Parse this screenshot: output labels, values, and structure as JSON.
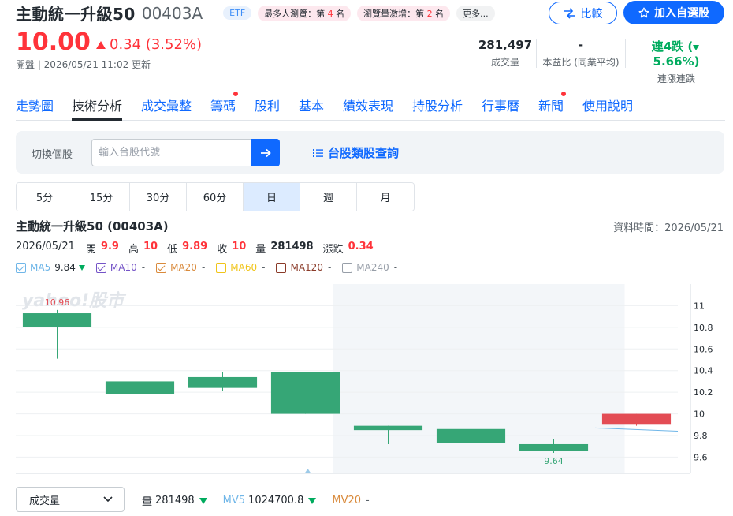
{
  "header": {
    "name": "主動統一升級50",
    "code": "00403A",
    "etf_badge": "ETF",
    "badge_views_prefix": "最多人瀏覽：第",
    "badge_views_rank": "4",
    "badge_views_suffix": "名",
    "badge_surge_prefix": "瀏覽量激增：第",
    "badge_surge_rank": "2",
    "badge_surge_suffix": "名",
    "badge_more": "更多...",
    "compare_label": "比較",
    "watchlist_label": "加入自選股"
  },
  "quote": {
    "price": "10.00",
    "change": "0.34 (3.52%)",
    "updated": "開盤 | 2026/05/21 11:02 更新",
    "volume_value": "281,497",
    "volume_label": "成交量",
    "pe_value": "-",
    "pe_label": "本益比 (同業平均)",
    "streak_value": "連4跌",
    "streak_pct": "5.66%",
    "streak_label": "連漲連跌"
  },
  "tabs": [
    {
      "label": "走勢圖",
      "dot": false
    },
    {
      "label": "技術分析",
      "dot": false,
      "active": true
    },
    {
      "label": "成交彙整",
      "dot": false
    },
    {
      "label": "籌碼",
      "dot": true
    },
    {
      "label": "股利",
      "dot": false
    },
    {
      "label": "基本",
      "dot": false
    },
    {
      "label": "績效表現",
      "dot": false
    },
    {
      "label": "持股分析",
      "dot": false
    },
    {
      "label": "行事曆",
      "dot": false
    },
    {
      "label": "新聞",
      "dot": true
    },
    {
      "label": "使用說明",
      "dot": false
    }
  ],
  "search": {
    "label": "切換個股",
    "placeholder": "輸入台股代號",
    "category_link": "台股類股查詢"
  },
  "periods": [
    "5分",
    "15分",
    "30分",
    "60分",
    "日",
    "週",
    "月"
  ],
  "chart_info": {
    "title": "主動統一升級50 (00403A)",
    "data_time": "資料時間：2026/05/21",
    "date": "2026/05/21",
    "open_label": "開",
    "open": "9.9",
    "high_label": "高",
    "high": "10",
    "low_label": "低",
    "low": "9.89",
    "close_label": "收",
    "close": "10",
    "vol_label": "量",
    "vol": "281498",
    "chg_label": "漲跌",
    "chg": "0.34"
  },
  "ma": [
    {
      "label": "MA5",
      "value": "9.84",
      "color": "#6fb6e8",
      "checked": true,
      "arrow": true
    },
    {
      "label": "MA10",
      "value": "-",
      "color": "#7453c7",
      "checked": true
    },
    {
      "label": "MA20",
      "value": "-",
      "color": "#d98a3b",
      "checked": true
    },
    {
      "label": "MA60",
      "value": "-",
      "color": "#f0c419",
      "checked": false
    },
    {
      "label": "MA120",
      "value": "-",
      "color": "#8a3a28",
      "checked": false
    },
    {
      "label": "MA240",
      "value": "-",
      "color": "#979ea8",
      "checked": false
    }
  ],
  "colors": {
    "up": "#e34c54",
    "down": "#36a676",
    "accent": "#0f69ff"
  },
  "chart_data": {
    "type": "candlestick",
    "watermark": "yahoo!股市",
    "ylim": [
      9.45,
      11.2
    ],
    "yticks": [
      "11",
      "10.8",
      "10.6",
      "10.4",
      "10.2",
      "10",
      "9.8",
      "9.6"
    ],
    "candles": [
      {
        "open": 10.93,
        "close": 10.8,
        "high": 10.96,
        "low": 10.51
      },
      {
        "open": 10.3,
        "close": 10.18,
        "high": 10.35,
        "low": 10.13
      },
      {
        "open": 10.34,
        "close": 10.24,
        "high": 10.39,
        "low": 10.21
      },
      {
        "open": 10.39,
        "close": 10.0,
        "high": 10.39,
        "low": 10.0
      },
      {
        "open": 9.89,
        "close": 9.85,
        "high": 9.89,
        "low": 9.72
      },
      {
        "open": 9.86,
        "close": 9.73,
        "high": 9.92,
        "low": 9.73
      },
      {
        "open": 9.72,
        "close": 9.66,
        "high": 9.77,
        "low": 9.64
      },
      {
        "open": 9.9,
        "close": 10.0,
        "high": 10.0,
        "low": 9.89
      }
    ],
    "max_label": "10.96",
    "min_label": "9.64",
    "ma5": [
      {
        "i": 6.5,
        "v": 9.87
      },
      {
        "i": 7.5,
        "v": 9.84
      }
    ]
  },
  "volume_bar": {
    "selector": "成交量",
    "vol_label": "量",
    "vol": "281498",
    "mv5_label": "MV5",
    "mv5": "1024700.8",
    "mv20_label": "MV20",
    "mv20": "-"
  }
}
